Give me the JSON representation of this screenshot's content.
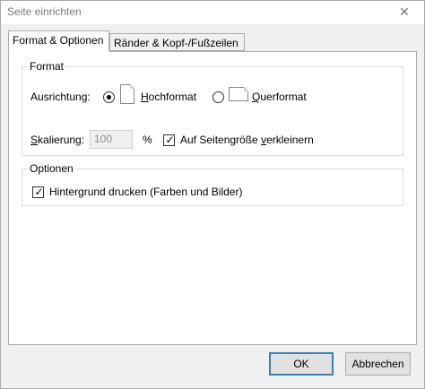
{
  "window": {
    "title": "Seite einrichten",
    "close_icon": "close-icon"
  },
  "tabs": [
    {
      "label": "Format & Optionen",
      "active": true
    },
    {
      "label": "Ränder & Kopf-/Fußzeilen",
      "active": false
    }
  ],
  "format_group": {
    "legend": "Format",
    "orientation_label": "Ausrichtung:",
    "portrait": {
      "label_first": "H",
      "label_rest": "ochformat",
      "selected": true,
      "icon": "portrait-page-icon"
    },
    "landscape": {
      "label_first": "Q",
      "label_rest": "uerformat",
      "selected": false,
      "icon": "landscape-page-icon"
    },
    "scale_label_first": "S",
    "scale_label_rest": "kalierung:",
    "scale_value": "100",
    "scale_unit": "%",
    "shrink_label_pre": "Auf Seitengröße ",
    "shrink_label_u": "v",
    "shrink_label_post": "erkleinern",
    "shrink_checked": true
  },
  "options_group": {
    "legend": "Optionen",
    "bg_label_pre": "Hinter",
    "bg_label_u": "g",
    "bg_label_post": "rund drucken (Farben und Bilder)",
    "bg_checked": true
  },
  "buttons": {
    "ok": "OK",
    "cancel": "Abbrechen"
  },
  "colors": {
    "accent_border": "#3c7fb1",
    "dialog_bg": "#f0f0f0"
  }
}
